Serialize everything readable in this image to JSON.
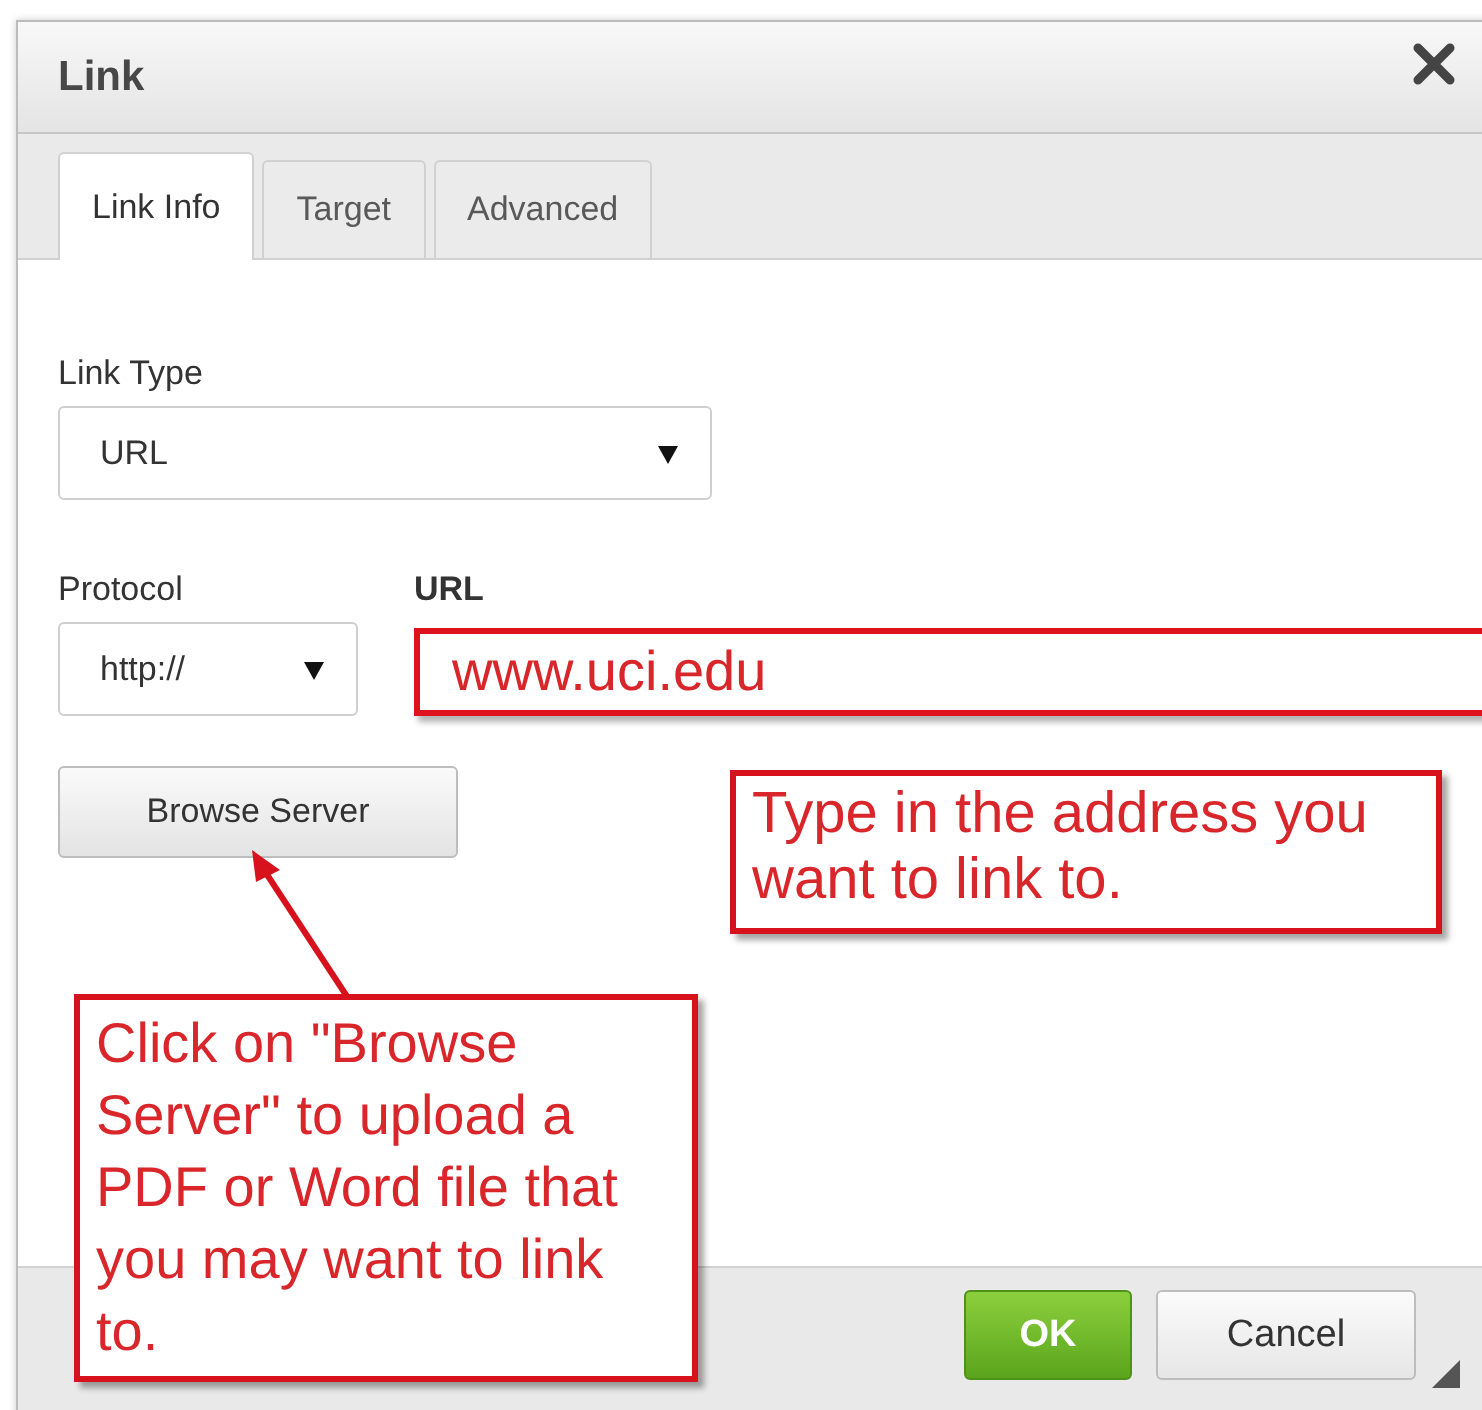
{
  "dialog": {
    "title": "Link"
  },
  "tabs": [
    {
      "label": "Link Info",
      "selected": true
    },
    {
      "label": "Target",
      "selected": false
    },
    {
      "label": "Advanced",
      "selected": false
    }
  ],
  "link_type": {
    "label": "Link Type",
    "value": "URL"
  },
  "protocol": {
    "label": "Protocol",
    "value": "http://"
  },
  "url": {
    "label": "URL",
    "value": "www.uci.edu",
    "highlighted": true
  },
  "browse_button": "Browse Server",
  "buttons": [
    {
      "label": "OK",
      "kind": "primary"
    },
    {
      "label": "Cancel",
      "kind": "secondary"
    }
  ],
  "annotations": [
    {
      "text": "Type in the address you want to link to.",
      "kind": "plain"
    },
    {
      "text": "Click on \"Browse Server\" to upload a PDF or Word file that you may want to link to.",
      "kind": "arrow"
    }
  ]
}
